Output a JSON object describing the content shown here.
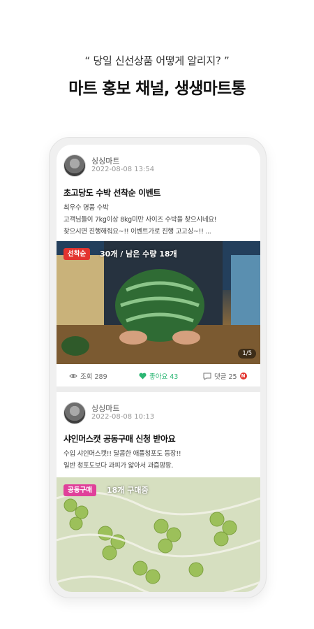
{
  "headline": {
    "subtitle": "“ 당일 신선상품 어떻게 알리지? ”",
    "title": "마트 홍보 채널, 생생마트통"
  },
  "posts": [
    {
      "author": "싱싱마트",
      "date": "2022-08-08 13:54",
      "title": "초고당도 수박 선착순 이벤트",
      "lines": [
        "최우수 명품 수박",
        "고객님들이 7kg이상 8kg미만 사이즈 수박을 찾으시네요!",
        "찾으시면 진행해줘요~!! 이벤트가로 진행 고고싱~!! ..."
      ],
      "tag": "선착순",
      "tag_info": "30개 / 남은 수량 18개",
      "image_counter": "1/5",
      "views": "조회 289",
      "likes": "좋아요 43",
      "comments": "댓글 25",
      "new_badge": "N"
    },
    {
      "author": "싱싱마트",
      "date": "2022-08-08 10:13",
      "title": "샤인머스캣 공동구매 신청 받아요",
      "lines": [
        "수입 샤인머스캣!! 달콤한 애플청포도 등장!!",
        "일반 청포도보다 과피가 얇아서 과즙팡팡."
      ],
      "tag": "공동구매",
      "tag_info": "18개 구매중"
    }
  ],
  "colors": {
    "like_green": "#2bb673",
    "tag_red": "#e3342f",
    "tag_pink": "#e0409a"
  },
  "icons": [
    "eye-icon",
    "heart-icon",
    "comment-icon"
  ]
}
